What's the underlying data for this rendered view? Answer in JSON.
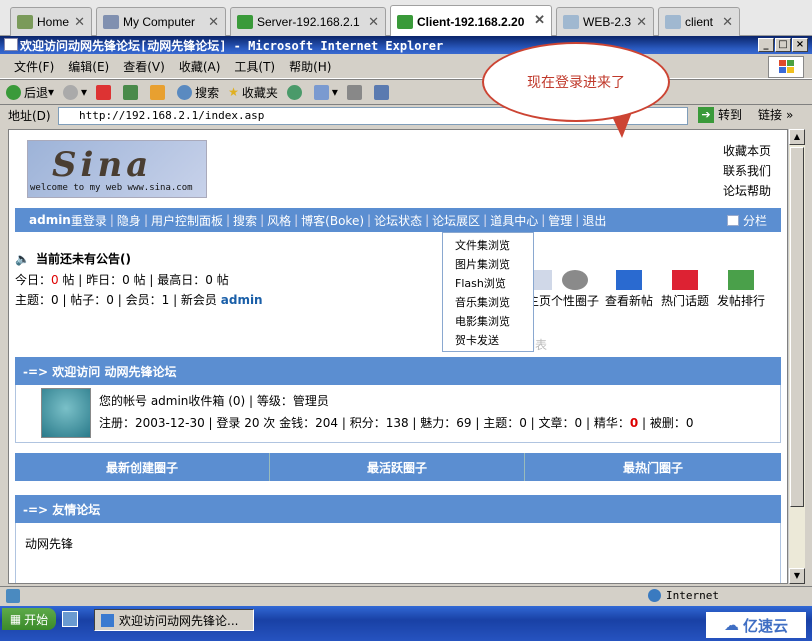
{
  "tabs": [
    {
      "label": "Home",
      "active": false
    },
    {
      "label": "My Computer",
      "active": false
    },
    {
      "label": "Server-192.168.2.1",
      "active": false
    },
    {
      "label": "Client-192.168.2.20",
      "active": true
    },
    {
      "label": "WEB-2.3",
      "active": false
    },
    {
      "label": "client",
      "active": false
    }
  ],
  "window": {
    "title": "欢迎访问动网先锋论坛[动网先锋论坛] - Microsoft Internet Explorer",
    "min": "_",
    "max": "□",
    "close": "×"
  },
  "menu": [
    "文件(F)",
    "编辑(E)",
    "查看(V)",
    "收藏(A)",
    "工具(T)",
    "帮助(H)"
  ],
  "toolbar": {
    "back": "后退",
    "search": "搜索",
    "favorites": "收藏夹"
  },
  "address": {
    "label": "地址(D)",
    "url": "http://192.168.2.1/index.asp",
    "go": "转到",
    "links": "链接"
  },
  "callout": "现在登录进来了",
  "page": {
    "logo_big": "Sina",
    "logo_small": "welcome to my web www.sina.com",
    "right_links": [
      "收藏本页",
      "联系我们",
      "论坛帮助"
    ],
    "nav": {
      "user": "admin",
      "items": [
        "重登录",
        "隐身",
        "用户控制面板",
        "搜索",
        "风格",
        "博客(Boke)",
        "论坛状态",
        "论坛展区",
        "道具中心",
        "管理",
        "退出"
      ],
      "fenlan": "分栏"
    },
    "dropdown": [
      "文件集浏览",
      "图片集浏览",
      "Flash浏览",
      "音乐集浏览",
      "电影集浏览",
      "贺卡发送"
    ],
    "announce": "当前还未有公告()",
    "stats1": {
      "today_label": "今日：",
      "today": "0",
      "t1": " 帖 | 昨日：0 帖 | 最高日：0 帖"
    },
    "stats2": {
      "text": "主题：0 | 帖子：0 | 会员：1 | 新会员 ",
      "newuser": "admin"
    },
    "quick": [
      "主页",
      "个性圈子",
      "查看新帖",
      "热门话题",
      "发帖排行"
    ],
    "ghost": "用户列表",
    "welcome_header": "-=> 欢迎访问 动网先锋论坛",
    "account": "您的帐号 admin收件箱 (0) | 等级：管理员",
    "reginfo": "注册：2003-12-30 | 登录 20 次 金钱：204 | 积分：138 | 魅力：69 | 主题：0 | 文章：0 | 精华：",
    "jinghua": "0",
    "banned": " | 被删：0",
    "circles": [
      "最新创建圈子",
      "最活跃圈子",
      "最热门圈子"
    ],
    "friend_header": "-=> 友情论坛",
    "friend": "动网先锋"
  },
  "status": {
    "zone": "Internet"
  },
  "taskbar": {
    "start": "开始",
    "task": "欢迎访问动网先锋论..."
  },
  "watermark": "亿速云"
}
